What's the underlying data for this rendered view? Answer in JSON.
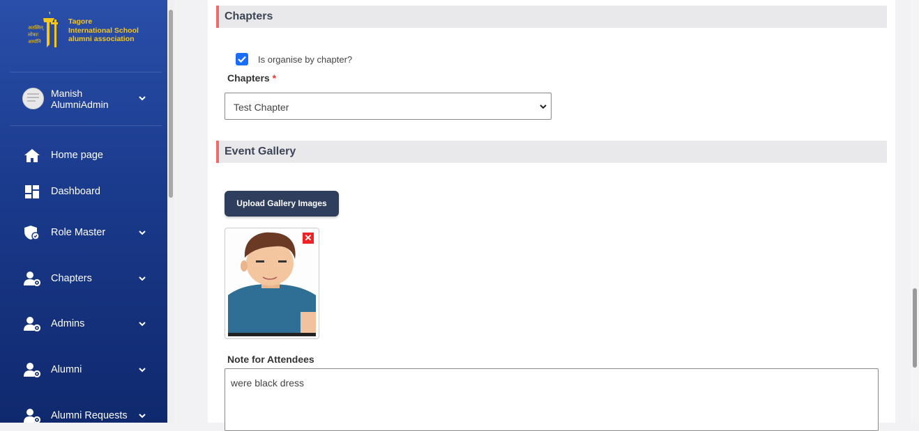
{
  "sidebar": {
    "logo_text": "Tagore\nInternational School\nalumni association",
    "logo_hindi": "अतस्मिन् लोकाः आर्यानि",
    "user": {
      "name": "Manish AlumniAdmin"
    },
    "items": [
      {
        "label": "Home page",
        "icon": "home-icon"
      },
      {
        "label": "Dashboard",
        "icon": "dashboard-icon"
      },
      {
        "label": "Role Master",
        "icon": "shield-icon"
      },
      {
        "label": "Chapters",
        "icon": "user-gear-icon"
      },
      {
        "label": "Admins",
        "icon": "user-gear-icon"
      },
      {
        "label": "Alumni",
        "icon": "user-gear-icon"
      },
      {
        "label": "Alumni Requests",
        "icon": "user-gear-icon"
      }
    ]
  },
  "chapters_section": {
    "title": "Chapters",
    "checkbox_label": "Is organise by chapter?",
    "checkbox_checked": true,
    "field_label": "Chapters",
    "required_mark": "*",
    "selected_value": "Test Chapter"
  },
  "gallery_section": {
    "title": "Event Gallery",
    "upload_button": "Upload Gallery Images",
    "delete_glyph": "✕"
  },
  "note": {
    "label": "Note for Attendees",
    "value": "were black dress"
  },
  "colors": {
    "sidebar_top": "#2a4faa",
    "sidebar_bottom": "#10296e",
    "accent_red": "#ef6b6b",
    "checkbox_blue": "#1a6ef5",
    "button_dark": "#2f3e5c",
    "logo_gold": "#f5c518"
  }
}
